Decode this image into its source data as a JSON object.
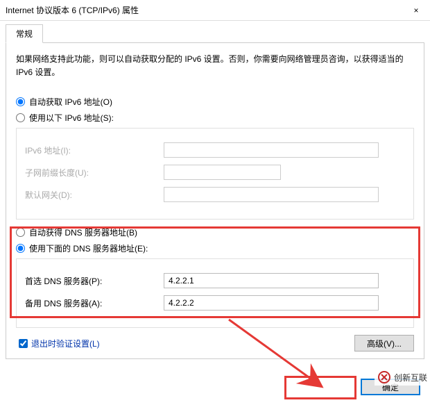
{
  "window": {
    "title": "Internet 协议版本 6 (TCP/IPv6) 属性",
    "close_label": "×"
  },
  "tab": {
    "general": "常规"
  },
  "description": "如果网络支持此功能，则可以自动获取分配的 IPv6 设置。否则，你需要向网络管理员咨询，以获得适当的 IPv6 设置。",
  "ip": {
    "auto_label": "自动获取 IPv6 地址(O)",
    "manual_label": "使用以下 IPv6 地址(S):",
    "address_label": "IPv6 地址(I):",
    "address_value": "",
    "prefix_label": "子网前缀长度(U):",
    "prefix_value": "",
    "gateway_label": "默认网关(D):",
    "gateway_value": ""
  },
  "dns": {
    "auto_label": "自动获得 DNS 服务器地址(B)",
    "manual_label": "使用下面的 DNS 服务器地址(E):",
    "preferred_label": "首选 DNS 服务器(P):",
    "preferred_value": "4.2.2.1",
    "alternate_label": "备用 DNS 服务器(A):",
    "alternate_value": "4.2.2.2"
  },
  "exit_validate": "退出时验证设置(L)",
  "buttons": {
    "advanced": "高级(V)...",
    "ok": "确定"
  },
  "watermark": "创新互联"
}
